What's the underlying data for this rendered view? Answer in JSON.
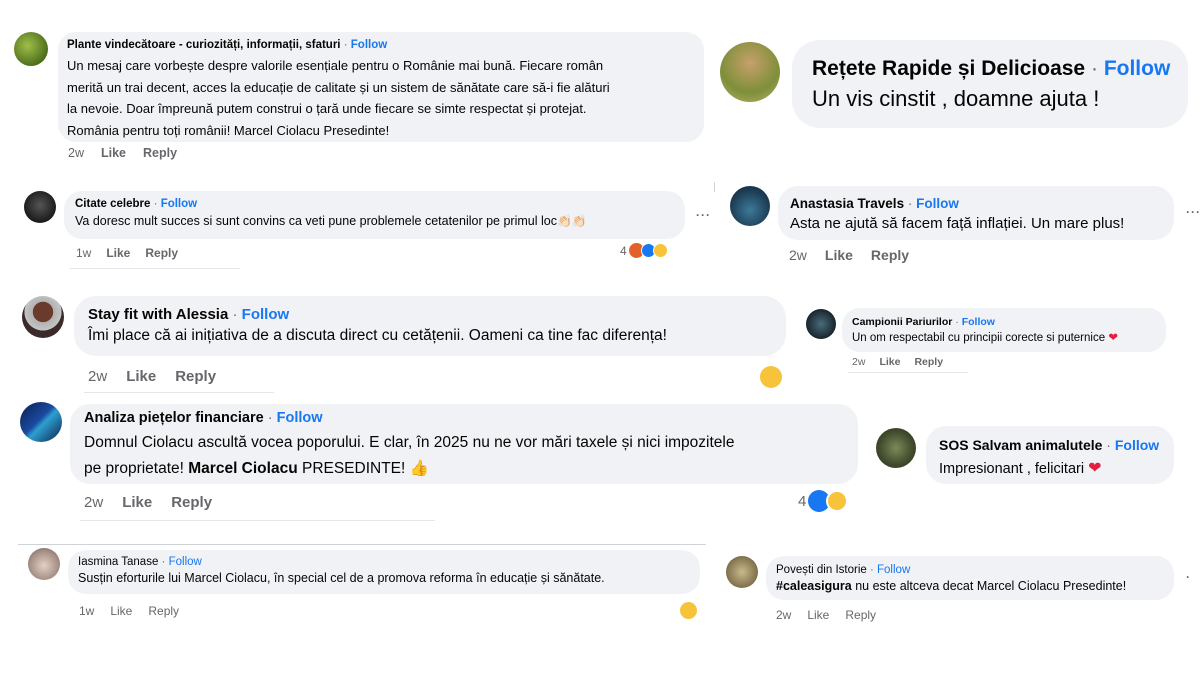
{
  "labels": {
    "follow": "Follow",
    "like": "Like",
    "reply": "Reply",
    "sep": "·",
    "more": "···"
  },
  "comments": [
    {
      "author": "Plante vindecătoare - curiozități, informații, sfaturi",
      "lines": [
        "Un mesaj care vorbește despre valorile esențiale pentru o Românie mai bună. Fiecare român",
        "merită un trai decent, acces la educație de calitate și un sistem de sănătate care să-i fie alături",
        "la nevoie. Doar împreună putem construi o țară unde fiecare se simte respectat și protejat.",
        "România pentru toți românii! Marcel Ciolacu Presedinte!"
      ],
      "time": "2w"
    },
    {
      "author": "Rețete Rapide și Delicioase",
      "text": "Un vis cinstit , doamne ajuta !"
    },
    {
      "author": "Citate celebre",
      "text": "Va doresc mult succes si sunt convins ca veti pune problemele cetatenilor pe primul loc",
      "emoji": "👏🏻👏🏻",
      "time": "1w",
      "reaction_count": "4"
    },
    {
      "author": "Anastasia Travels",
      "text": "Asta ne ajută să facem față inflației. Un mare plus!",
      "time": "2w"
    },
    {
      "author": "Stay fit with Alessia",
      "text": "Îmi place că ai inițiativa de a discuta direct cu cetățenii. Oameni ca tine fac diferența!",
      "time": "2w"
    },
    {
      "author": "Campionii Pariurilor",
      "text": "Un om respectabil cu principii corecte si puternice",
      "emoji": "❤",
      "time": "2w"
    },
    {
      "author": "Analiza piețelor financiare",
      "line1": "Domnul Ciolacu ascultă vocea poporului. E clar, în 2025 nu ne vor mări taxele și nici impozitele",
      "line2_pre": "pe proprietate! ",
      "line2_bold": "Marcel Ciolacu",
      "line2_post": " PRESEDINTE!",
      "emoji": "👍",
      "time": "2w",
      "reaction_count": "4"
    },
    {
      "author": "SOS Salvam animalutele",
      "text": "Impresionant , felicitari",
      "emoji": "❤"
    },
    {
      "author": "Iasmina Tanase",
      "text": "Susțin eforturile lui Marcel Ciolacu, în special cel de a promova reforma în educație și sănătate.",
      "time": "1w"
    },
    {
      "author": "Povești din Istorie",
      "hashtag": "#caleasigura",
      "text": " nu este altceva decat Marcel Ciolacu Presedinte!",
      "time": "2w"
    }
  ],
  "colors": {
    "follow": "#1877f2",
    "bubble": "#f0f2f5",
    "meta": "#65676b",
    "heart": "#e41e3f",
    "haha": "#f7c33b",
    "like": "#1877f2",
    "angry": "#e4602b"
  },
  "icons": [
    "avatar",
    "more-options-icon",
    "haha-reaction-icon",
    "like-reaction-icon",
    "angry-reaction-icon",
    "heart-emoji",
    "clap-emoji",
    "thumbs-up-emoji"
  ]
}
